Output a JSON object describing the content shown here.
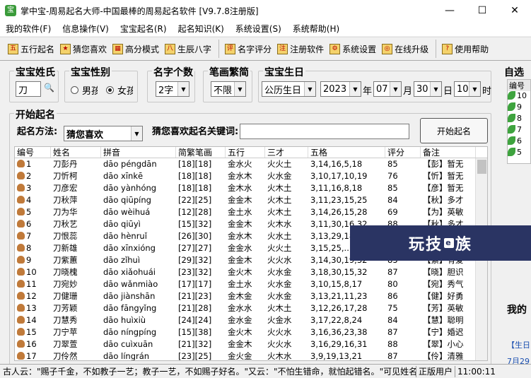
{
  "window": {
    "title": "掌中宝-周易起名大师-中国最棒的周易起名软件 [V9.7.8注册版]",
    "minimize": "—",
    "maximize": "☐",
    "close": "✕"
  },
  "menu": [
    "我的软件(F)",
    "信息操作(V)",
    "宝宝起名(R)",
    "起名知识(K)",
    "系统设置(S)",
    "系统帮助(H)"
  ],
  "toolbar": [
    {
      "label": "五行起名",
      "icon": "wuxing-icon",
      "glyph": "五"
    },
    {
      "label": "猜您喜欢",
      "icon": "star-icon",
      "glyph": "★"
    },
    {
      "label": "高分模式",
      "icon": "chart-icon",
      "glyph": "▦"
    },
    {
      "label": "生辰八字",
      "icon": "bazi-icon",
      "glyph": "八"
    },
    {
      "label": "名字评分",
      "icon": "score-icon",
      "glyph": "评"
    },
    {
      "label": "注册软件",
      "icon": "register-icon",
      "glyph": "注"
    },
    {
      "label": "系统设置",
      "icon": "settings-icon",
      "glyph": "⚙"
    },
    {
      "label": "在线升级",
      "icon": "globe-icon",
      "glyph": "◎"
    },
    {
      "label": "使用帮助",
      "icon": "help-icon",
      "glyph": "?"
    }
  ],
  "form": {
    "surname_label": "宝宝姓氏",
    "surname_value": "刀",
    "search_glyph": "🔍",
    "gender_label": "宝宝性别",
    "gender_male": "男孩",
    "gender_female": "女孩",
    "name_count_label": "名字个数",
    "name_count_value": "2字",
    "stroke_label": "笔画繁简",
    "stroke_value": "不限",
    "birthday_label": "宝宝生日",
    "calendar_value": "公历生日",
    "year_value": "2023",
    "year_unit": "年",
    "month_value": "07",
    "month_unit": "月",
    "day_value": "30",
    "day_unit": "日",
    "hour_value": "10",
    "hour_unit": "时",
    "start_group_label": "开始起名",
    "method_label": "起名方法:",
    "method_value": "猜您喜欢",
    "keyword_label": "猜您喜欢起名关键词:",
    "keyword_value": "",
    "start_button": "开始起名"
  },
  "table": {
    "headers": [
      "编号",
      "姓名",
      "拼音",
      "简繁笔画",
      "五行",
      "三才",
      "五格",
      "评分",
      "备注"
    ],
    "rows": [
      [
        "1",
        "刀彭丹",
        "dāo péngdān",
        "[18][18]",
        "金水火",
        "火火土",
        "3,14,16,5,18",
        "85",
        "【彭】暂无"
      ],
      [
        "2",
        "刀忻柯",
        "dāo xīnkē",
        "[18][18]",
        "金水木",
        "火水金",
        "3,10,17,10,19",
        "76",
        "【忻】暂无"
      ],
      [
        "3",
        "刀彦宏",
        "dāo yànhóng",
        "[18][18]",
        "金木水",
        "火木土",
        "3,11,16,8,18",
        "85",
        "【彦】暂无"
      ],
      [
        "4",
        "刀秋萍",
        "dāo qiūpíng",
        "[22][25]",
        "金金木",
        "火木土",
        "3,11,23,15,25",
        "84",
        "【秋】多才"
      ],
      [
        "5",
        "刀为华",
        "dāo wèihuá",
        "[12][28]",
        "金土水",
        "火木土",
        "3,14,26,15,28",
        "69",
        "【为】英敏"
      ],
      [
        "6",
        "刀秋艺",
        "dāo qiūyì",
        "[15][32]",
        "金金木",
        "火木水",
        "3,11,30,16,32",
        "88",
        "【秋】多才"
      ],
      [
        "7",
        "刀恨蕊",
        "dāo hènruǐ",
        "[26][30]",
        "金水木",
        "火水土",
        "3,13,29,18,30",
        "88",
        "【恨】暂无"
      ],
      [
        "8",
        "刀新雄",
        "dāo xīnxióng",
        "[27][27]",
        "金金水",
        "火火土",
        "3,15,25,...",
        "88",
        "【新】暂无"
      ],
      [
        "9",
        "刀紫蕙",
        "dāo zǐhuì",
        "[29][32]",
        "金金木",
        "火火水",
        "3,14,30,19,32",
        "85",
        "【紫】有爱"
      ],
      [
        "10",
        "刀晓槐",
        "dāo xiǎohuái",
        "[23][32]",
        "金火木",
        "火水金",
        "3,18,30,15,32",
        "87",
        "【晓】胆识"
      ],
      [
        "11",
        "刀宛妙",
        "dāo wǎnmiào",
        "[17][17]",
        "金土水",
        "火水金",
        "3,10,15,8,17",
        "80",
        "【宛】秀气"
      ],
      [
        "12",
        "刀健珊",
        "dāo jiànshān",
        "[21][23]",
        "金木金",
        "火水金",
        "3,13,21,11,23",
        "86",
        "【健】好勇"
      ],
      [
        "13",
        "刀芳颖",
        "dāo fāngyǐng",
        "[21][28]",
        "金水水",
        "火木土",
        "3,12,26,17,28",
        "75",
        "【芳】英敏"
      ],
      [
        "14",
        "刀慧秀",
        "dāo huìxiù",
        "[24][24]",
        "金水金",
        "火金水",
        "3,17,22,8,24",
        "84",
        "【慧】聪明"
      ],
      [
        "15",
        "刀宁苹",
        "dāo níngpíng",
        "[15][38]",
        "金火木",
        "火火水",
        "3,16,36,23,38",
        "87",
        "【宁】婚迟"
      ],
      [
        "16",
        "刀翠萱",
        "dāo cuìxuān",
        "[21][32]",
        "金金木",
        "火火水",
        "3,16,29,16,31",
        "88",
        "【翠】小心"
      ],
      [
        "17",
        "刀伶然",
        "dāo língrán",
        "[23][25]",
        "金火金",
        "火木水",
        "3,9,19,13,21",
        "87",
        "【伶】清雅"
      ]
    ]
  },
  "right_panel": {
    "group_label": "自选",
    "header": "编号",
    "items": [
      "10",
      "9",
      "8",
      "7",
      "6",
      "5"
    ],
    "group2_label": "我的",
    "link": "【生日",
    "link2": "7月29"
  },
  "watermark": {
    "text_a": "玩技",
    "badge": "e",
    "text_b": "族"
  },
  "statusbar": {
    "proverb": "古人云：\"赐子千金，不如教子一艺；教子一艺，不如赐子好名。\"又云：\"不怕生错命，就怕起错名。\"可见姓名",
    "edition": "正版用户",
    "time": "11:00:11"
  }
}
